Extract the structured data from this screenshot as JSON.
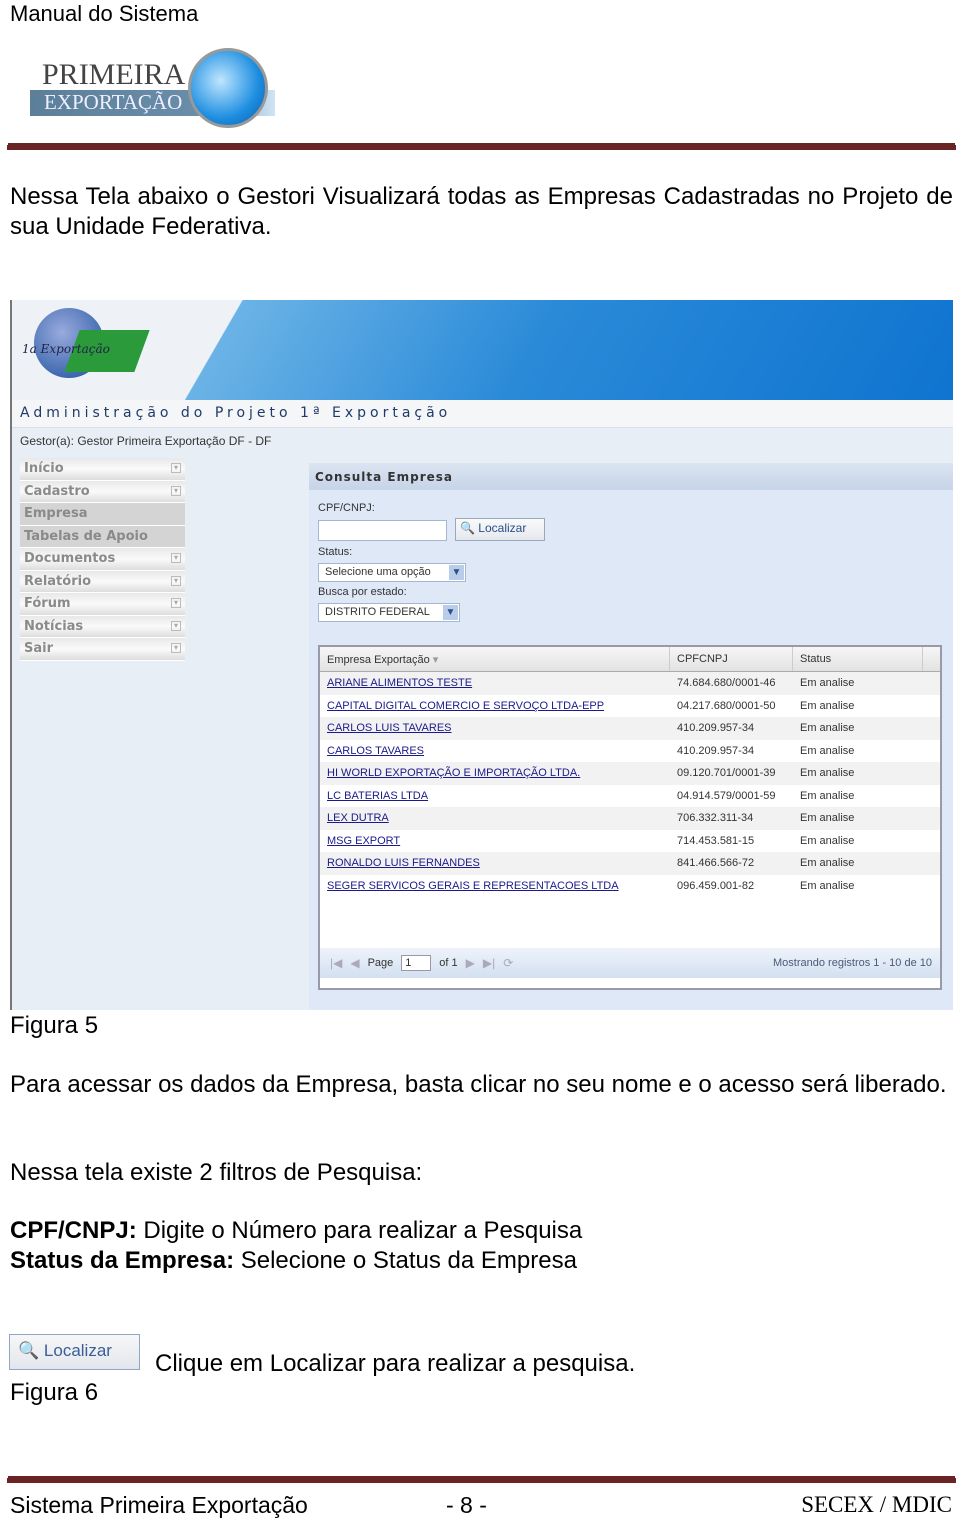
{
  "header": {
    "title": "Manual do Sistema",
    "logo": {
      "line1": "PRIMEIRA",
      "line2": "EXPORTAÇÃO"
    }
  },
  "intro": "Nessa Tela abaixo o Gestori Visualizará todas as Empresas Cadastradas no Projeto de sua Unidade Federativa.",
  "screenshot": {
    "logo_text": "1a Exportação",
    "admin_title": "Administração do Projeto 1ª Exportação",
    "gestor": "Gestor(a): Gestor Primeira Exportação DF - DF",
    "menu": [
      {
        "label": "Início",
        "toggle": true
      },
      {
        "label": "Cadastro",
        "toggle": true
      },
      {
        "label": "Empresa",
        "toggle": false
      },
      {
        "label": "Tabelas de Apoio",
        "toggle": false
      },
      {
        "label": "Documentos",
        "toggle": true
      },
      {
        "label": "Relatório",
        "toggle": true
      },
      {
        "label": "Fórum",
        "toggle": true
      },
      {
        "label": "Notícias",
        "toggle": true
      },
      {
        "label": "Sair",
        "toggle": true
      }
    ],
    "panel_title": "Consulta Empresa",
    "cpf_label": "CPF/CNPJ:",
    "cpf_value": "",
    "localizar": "Localizar",
    "status_label": "Status:",
    "status_value": "Selecione uma opção",
    "estado_label": "Busca por estado:",
    "estado_value": "DISTRITO FEDERAL",
    "columns": [
      "Empresa Exportação",
      "CPFCNPJ",
      "Status"
    ],
    "rows": [
      [
        "ARIANE ALIMENTOS TESTE",
        "74.684.680/0001-46",
        "Em analise"
      ],
      [
        "CAPITAL DIGITAL COMERCIO E SERVOÇO LTDA-EPP",
        "04.217.680/0001-50",
        "Em analise"
      ],
      [
        "CARLOS LUIS TAVARES",
        "410.209.957-34",
        "Em analise"
      ],
      [
        "CARLOS TAVARES",
        "410.209.957-34",
        "Em analise"
      ],
      [
        "HI WORLD EXPORTAÇÃO E IMPORTAÇÃO LTDA.",
        "09.120.701/0001-39",
        "Em analise"
      ],
      [
        "LC BATERIAS LTDA",
        "04.914.579/0001-59",
        "Em analise"
      ],
      [
        "LEX DUTRA",
        "706.332.311-34",
        "Em analise"
      ],
      [
        "MSG EXPORT",
        "714.453.581-15",
        "Em analise"
      ],
      [
        "RONALDO LUIS FERNANDES",
        "841.466.566-72",
        "Em analise"
      ],
      [
        "SEGER SERVICOS GERAIS E REPRESENTACOES LTDA",
        "096.459.001-82",
        "Em analise"
      ]
    ],
    "pager": {
      "page_label": "Page",
      "page": "1",
      "of": "of 1",
      "summary": "Mostrando registros 1 - 10 de 10"
    }
  },
  "fig5": "Figura 5",
  "para1": "Para acessar os dados da Empresa, basta clicar no seu nome e o acesso será liberado.",
  "para2": "Nessa tela existe 2 filtros de Pesquisa:",
  "f1_bold": "CPF/CNPJ:",
  "f1_text": " Digite o Número para realizar a Pesquisa",
  "f2_bold": "Status da Empresa:",
  "f2_text": " Selecione o Status da Empresa",
  "fig6_button": "Localizar",
  "fig6_text": "Clique em Localizar para realizar a pesquisa.",
  "fig6": "Figura 6",
  "footer": {
    "left": "Sistema Primeira Exportação",
    "center": "- 8 -",
    "right": "SECEX / MDIC"
  },
  "colors": {
    "rule": "#6b2426",
    "link": "#1a1a8a",
    "banner": "#0f74d0"
  }
}
